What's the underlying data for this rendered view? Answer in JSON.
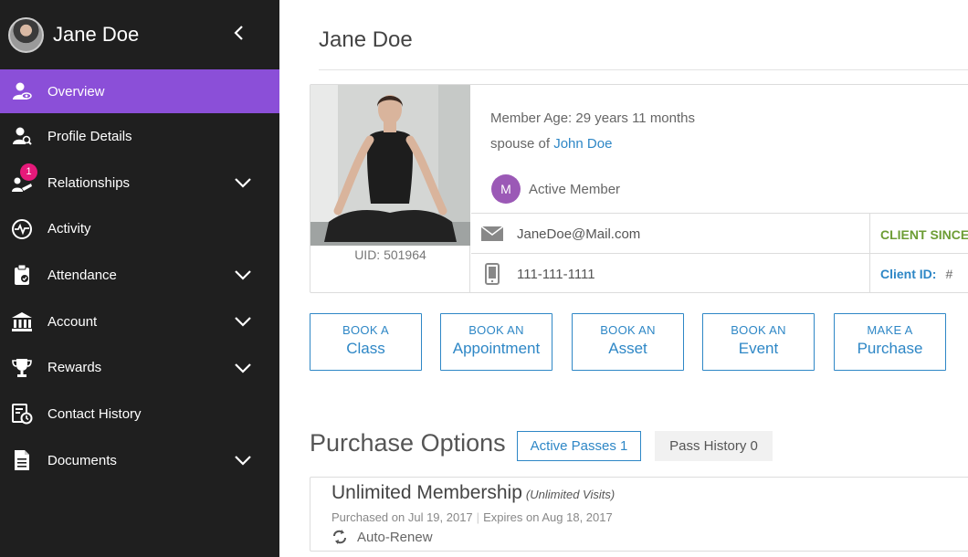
{
  "sidebar": {
    "user_name": "Jane Doe",
    "items": [
      {
        "label": "Overview",
        "icon": "user-eye-icon",
        "active": true,
        "expandable": false
      },
      {
        "label": "Profile Details",
        "icon": "user-search-icon",
        "active": false,
        "expandable": false
      },
      {
        "label": "Relationships",
        "icon": "relationships-icon",
        "active": false,
        "expandable": true,
        "badge": "1"
      },
      {
        "label": "Activity",
        "icon": "heartbeat-icon",
        "active": false,
        "expandable": false
      },
      {
        "label": "Attendance",
        "icon": "clipboard-check-icon",
        "active": false,
        "expandable": true
      },
      {
        "label": "Account",
        "icon": "bank-icon",
        "active": false,
        "expandable": true
      },
      {
        "label": "Rewards",
        "icon": "trophy-icon",
        "active": false,
        "expandable": true
      },
      {
        "label": "Contact History",
        "icon": "contact-history-icon",
        "active": false,
        "expandable": false
      },
      {
        "label": "Documents",
        "icon": "document-icon",
        "active": false,
        "expandable": true
      }
    ]
  },
  "main": {
    "title": "Jane Doe",
    "profile": {
      "uid": "UID: 501964",
      "age": "Member Age: 29 years 11 months",
      "spouse_prefix": "spouse of ",
      "spouse_name": "John Doe",
      "member_initial": "M",
      "member_status": "Active Member",
      "email": "JaneDoe@Mail.com",
      "phone": "111-111-1111",
      "client_since_label": "CLIENT SINCE:",
      "client_id_label": "Client ID:",
      "client_id_value": "#"
    },
    "actions": [
      {
        "top": "BOOK A",
        "bottom": "Class"
      },
      {
        "top": "BOOK AN",
        "bottom": "Appointment"
      },
      {
        "top": "BOOK AN",
        "bottom": "Asset"
      },
      {
        "top": "BOOK AN",
        "bottom": "Event"
      },
      {
        "top": "MAKE A",
        "bottom": "Purchase"
      }
    ],
    "purchase_options": {
      "title": "Purchase Options",
      "tab_active": "Active Passes 1",
      "tab_inactive": "Pass History 0",
      "membership": {
        "name": "Unlimited Membership",
        "subtitle": "(Unlimited Visits)",
        "purchased": "Purchased on Jul 19, 2017",
        "expires": "Expires on Aug 18, 2017",
        "renew": "Auto-Renew"
      }
    }
  },
  "colors": {
    "sidebar_bg": "#1f1f1f",
    "active_item": "#8b4fd8",
    "accent_blue": "#2e87c6",
    "client_since_green": "#6d9d35",
    "badge_pink": "#e6197a",
    "member_purple": "#9b59b6"
  }
}
